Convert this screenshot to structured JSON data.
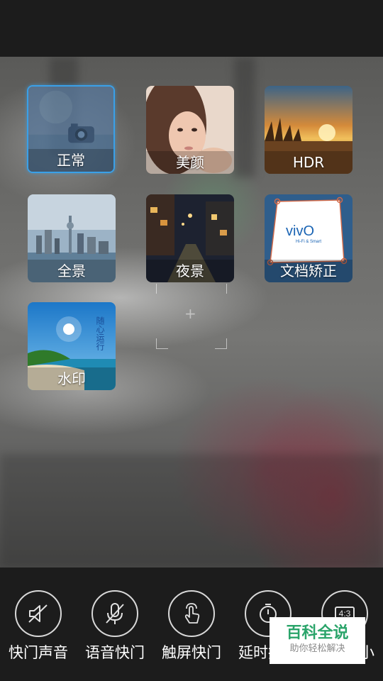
{
  "modes": [
    {
      "label": "正常",
      "selected": true
    },
    {
      "label": "美颜",
      "selected": false
    },
    {
      "label": "HDR",
      "selected": false
    },
    {
      "label": "全景",
      "selected": false
    },
    {
      "label": "夜景",
      "selected": false
    },
    {
      "label": "文档矫正",
      "selected": false
    },
    {
      "label": "水印",
      "selected": false
    }
  ],
  "thumb_text": {
    "vivo_logo": "vivO",
    "vivo_tagline": "Hi-Fi & Smart",
    "watermark_vertical": "随心运行"
  },
  "settings": [
    {
      "label": "快门声音",
      "icon": "speaker-muted-icon"
    },
    {
      "label": "语音快门",
      "icon": "microphone-muted-icon"
    },
    {
      "label": "触屏快门",
      "icon": "touch-hand-icon"
    },
    {
      "label": "延时拍照",
      "icon": "timer-icon"
    },
    {
      "label": "照片大小",
      "icon": "aspect-ratio-icon",
      "badge": "4:3"
    }
  ],
  "site_watermark": {
    "title": "百科全说",
    "subtitle": "助你轻松解决"
  },
  "colors": {
    "selection_border": "#3aa0e8",
    "watermark_green": "#2aa46a"
  }
}
